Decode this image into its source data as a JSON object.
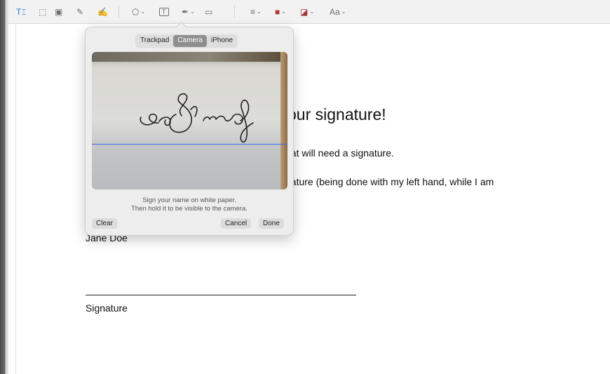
{
  "toolbar": {
    "items": [
      {
        "name": "text-selection-icon",
        "glyph": "T⌶"
      },
      {
        "name": "rect-selection-icon",
        "glyph": "⬚"
      },
      {
        "name": "redact-icon",
        "glyph": "▣"
      },
      {
        "name": "sketch-icon",
        "glyph": "✎"
      },
      {
        "name": "draw-icon",
        "glyph": "✍"
      },
      {
        "name": "shapes-icon",
        "glyph": "⬠"
      },
      {
        "name": "text-box-icon",
        "glyph": "T"
      },
      {
        "name": "signature-icon",
        "glyph": "✒"
      },
      {
        "name": "note-icon",
        "glyph": "▭"
      },
      {
        "name": "shape-style-icon",
        "glyph": "≡"
      },
      {
        "name": "border-color-icon",
        "glyph": "■"
      },
      {
        "name": "fill-color-icon",
        "glyph": "◪"
      },
      {
        "name": "text-style-icon",
        "glyph": "Aa"
      }
    ],
    "chevron": "⌄"
  },
  "popover": {
    "tabs": [
      "Trackpad",
      "Camera",
      "iPhone"
    ],
    "active_tab": "Camera",
    "instruction_line1": "Sign your name on white paper.",
    "instruction_line2": "Then hold it to be visible to the camera.",
    "clear_label": "Clear",
    "cancel_label": "Cancel",
    "done_label": "Done"
  },
  "document": {
    "heading_visible": "our signature!",
    "line1_visible": "hat will need a signature.",
    "line2_visible": "nature (being done with my left hand, while I am",
    "name": "Jane Doe",
    "signature_label": "Signature"
  },
  "colors": {
    "active_tab": "#8e8e8e",
    "guide_line": "#3b6fe6",
    "ink": "#222222"
  }
}
